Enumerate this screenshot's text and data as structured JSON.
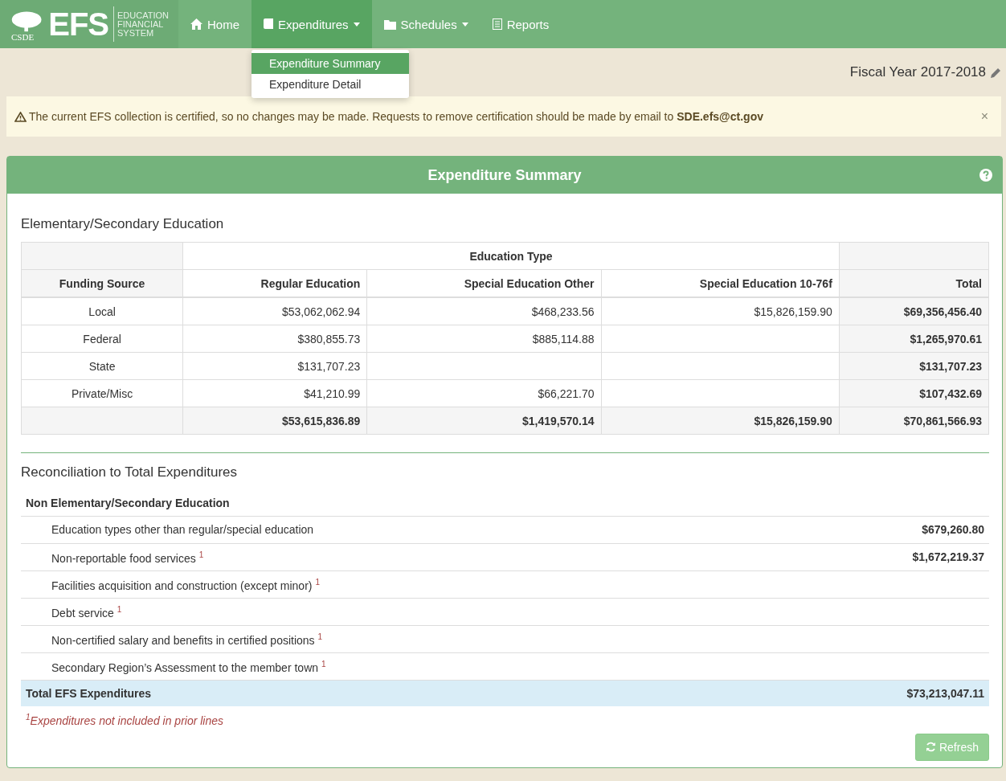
{
  "brand": {
    "logo_text": "CSDE",
    "title": "EFS",
    "subtitle_lines": [
      "EDUCATION",
      "FINANCIAL",
      "SYSTEM"
    ]
  },
  "nav": [
    {
      "label": "Home",
      "kind": "link",
      "selected": false
    },
    {
      "label": "Expenditures",
      "kind": "dropdown",
      "selected": true,
      "menu": [
        {
          "label": "Expenditure Summary",
          "selected": true
        },
        {
          "label": "Expenditure Detail",
          "selected": false
        }
      ]
    },
    {
      "label": "Schedules",
      "kind": "dropdown",
      "selected": false
    },
    {
      "label": "Reports",
      "kind": "link",
      "selected": false
    }
  ],
  "fiscal_year": "Fiscal Year 2017-2018",
  "alert": {
    "text": "The current EFS collection is certified, so no changes may be made. Requests to remove certification should be made by email to **SDE.efs@ct.gov**",
    "close": "×"
  },
  "panel": {
    "title": "Expenditure Summary",
    "section_title": "Elementary/Secondary Education",
    "table": {
      "group_header": "Education Type",
      "columns": [
        "Funding Source",
        "Regular Education",
        "Special Education Other",
        "Special Education 10-76f",
        "Total"
      ],
      "rows": [
        [
          "Local",
          "$53,062,062.94",
          "$468,233.56",
          "$15,826,159.90",
          "$69,356,456.40"
        ],
        [
          "Federal",
          "$380,855.73",
          "$885,114.88",
          "",
          "$1,265,970.61"
        ],
        [
          "State",
          "$131,707.23",
          "",
          "",
          "$131,707.23"
        ],
        [
          "Private/Misc",
          "$41,210.99",
          "$66,221.70",
          "",
          "$107,432.69"
        ]
      ],
      "total_row": [
        "$53,615,836.89",
        "$1,419,570.14",
        "$15,826,159.90",
        "$70,861,566.93"
      ]
    },
    "reconciliation": {
      "title": "Reconciliation to Total Expenditures",
      "group": "Non Elementary/Secondary Education",
      "items": [
        {
          "label": "Education types other than regular/special education",
          "value": "$679,260.80"
        },
        {
          "label": "Non-reportable food services $^{1}$",
          "value": "$1,672,219.37"
        },
        {
          "label": "Facilities acquisition and construction (except minor) $^{1}$",
          "value": ""
        },
        {
          "label": "Debt service $^{1}$",
          "value": ""
        },
        {
          "label": "Non-certified salary and benefits in certified positions $^{1}$",
          "value": ""
        },
        {
          "label": "Secondary Region’s Assessment to the member town $^{1}$",
          "value": ""
        }
      ],
      "total": {
        "label": "Total EFS Expenditures",
        "value": "$73,213,047.11"
      },
      "footnote": "$^{1}$Expenditures not included in prior lines"
    },
    "refresh": {
      "label": "Refresh",
      "disabled": true
    }
  }
}
